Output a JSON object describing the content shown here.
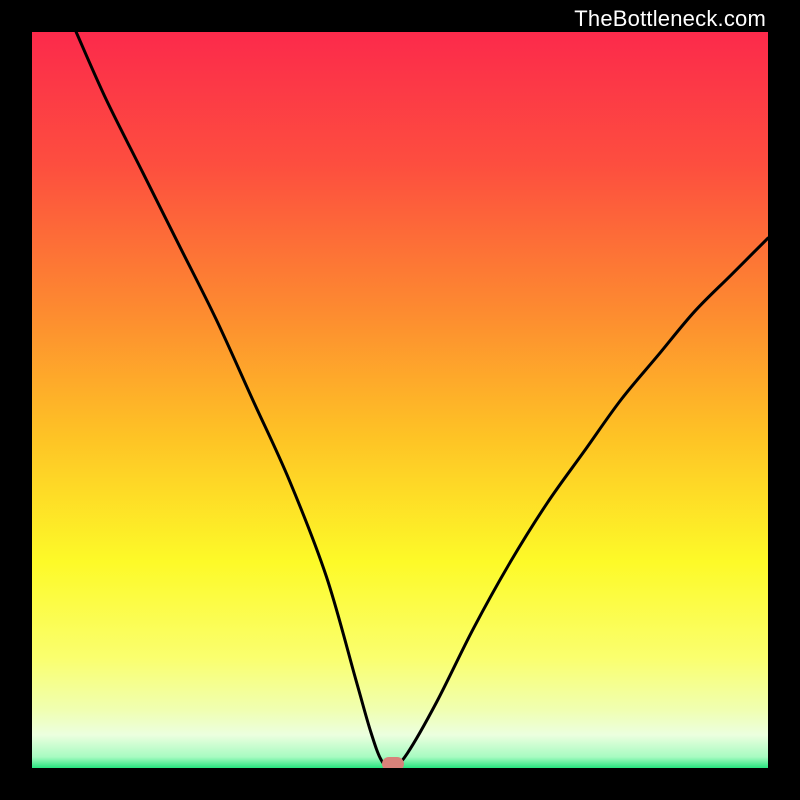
{
  "watermark": "TheBottleneck.com",
  "chart_data": {
    "type": "line",
    "title": "",
    "xlabel": "",
    "ylabel": "",
    "xlim": [
      0,
      100
    ],
    "ylim": [
      0,
      100
    ],
    "x": [
      6,
      10,
      15,
      20,
      25,
      30,
      35,
      40,
      44,
      46,
      47.5,
      49,
      51,
      55,
      60,
      65,
      70,
      75,
      80,
      85,
      90,
      95,
      100
    ],
    "y": [
      100,
      91,
      81,
      71,
      61,
      50,
      39,
      26,
      12,
      5,
      1,
      0,
      2,
      9,
      19,
      28,
      36,
      43,
      50,
      56,
      62,
      67,
      72
    ],
    "marker": {
      "x": 49,
      "y": 0,
      "color": "#d8827a"
    },
    "gradient_stops": [
      {
        "offset": 0,
        "color": "#fc2a4b"
      },
      {
        "offset": 0.18,
        "color": "#fd4e3f"
      },
      {
        "offset": 0.38,
        "color": "#fd8b30"
      },
      {
        "offset": 0.55,
        "color": "#fec325"
      },
      {
        "offset": 0.72,
        "color": "#fdfa28"
      },
      {
        "offset": 0.85,
        "color": "#faff6e"
      },
      {
        "offset": 0.92,
        "color": "#f0ffb0"
      },
      {
        "offset": 0.955,
        "color": "#ecffdf"
      },
      {
        "offset": 0.985,
        "color": "#a7fbc1"
      },
      {
        "offset": 1.0,
        "color": "#27e47f"
      }
    ]
  }
}
